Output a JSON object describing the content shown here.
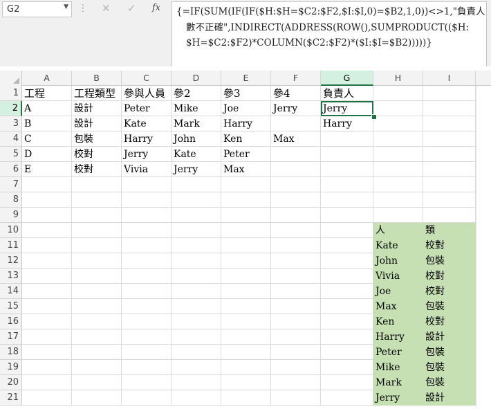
{
  "name_box": {
    "value": "G2",
    "dropdown_icon": "chevron-down-icon"
  },
  "formula_bar": {
    "cancel_icon": "✕",
    "enter_icon": "✓",
    "fx_label": "fx",
    "formula_lines": [
      "{=IF(SUM(IF(IF($H:$H=$C2:$F2,$I:$I,0)=$B2,1,0))<>1,\"負責人",
      "數不正確\",INDIRECT(ADDRESS(ROW(),SUMPRODUCT(($H:",
      "$H=$C2:$F2)*COLUMN($C2:$F2)*($I:$I=$B2)))))}"
    ]
  },
  "selected": {
    "column": "G",
    "row": "2"
  },
  "columns": [
    "A",
    "B",
    "C",
    "D",
    "E",
    "F",
    "G",
    "H",
    "I"
  ],
  "rows": [
    "1",
    "2",
    "3",
    "4",
    "5",
    "6",
    "7",
    "8",
    "9",
    "10",
    "11",
    "12",
    "13",
    "14",
    "15",
    "16",
    "17",
    "18",
    "19",
    "20",
    "21"
  ],
  "cells": {
    "A1": "工程",
    "B1": "工程類型",
    "C1": "參與人員",
    "D1": "參2",
    "E1": "參3",
    "F1": "參4",
    "G1": "負責人",
    "A2": "A",
    "B2": "設計",
    "C2": "Peter",
    "D2": "Mike",
    "E2": "Joe",
    "F2": "Jerry",
    "G2": "Jerry",
    "A3": "B",
    "B3": "設計",
    "C3": "Kate",
    "D3": "Mark",
    "E3": "Harry",
    "G3": "Harry",
    "A4": "C",
    "B4": "包裝",
    "C4": "Harry",
    "D4": "John",
    "E4": "Ken",
    "F4": "Max",
    "A5": "D",
    "B5": "校對",
    "C5": "Jerry",
    "D5": "Kate",
    "E5": "Peter",
    "A6": "E",
    "B6": "校對",
    "C6": "Vivia",
    "D6": "Jerry",
    "E6": "Max",
    "H10": "人",
    "I10": "類",
    "H11": "Kate",
    "I11": "校對",
    "H12": "John",
    "I12": "包裝",
    "H13": "Vivia",
    "I13": "校對",
    "H14": "Joe",
    "I14": "校對",
    "H15": "Max",
    "I15": "包裝",
    "H16": "Ken",
    "I16": "校對",
    "H17": "Harry",
    "I17": "設計",
    "H18": "Peter",
    "I18": "包裝",
    "H19": "Mike",
    "I19": "包裝",
    "H20": "Mark",
    "I20": "包裝",
    "H21": "Jerry",
    "I21": "設計"
  },
  "highlight_color": "#c6e0b4",
  "accent_color": "#217346"
}
